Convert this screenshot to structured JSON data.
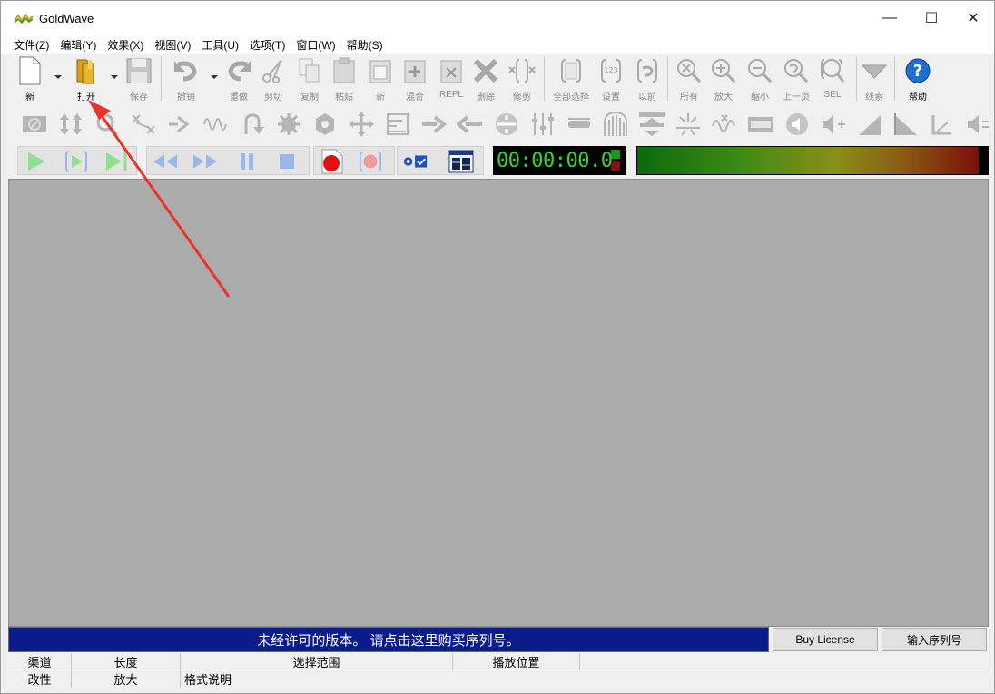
{
  "window": {
    "title": "GoldWave"
  },
  "window_controls": {
    "minimize": "—",
    "maximize": "☐",
    "close": "✕"
  },
  "menu": [
    "文件(Z)",
    "编辑(Y)",
    "效果(X)",
    "视图(V)",
    "工具(U)",
    "选项(T)",
    "窗口(W)",
    "帮助(S)"
  ],
  "toolbar_main": {
    "new": "新",
    "open": "打开",
    "save": "保存",
    "undo": "撤销",
    "redo": "重做",
    "cut": "剪切",
    "copy": "复制",
    "paste": "粘贴",
    "paste_new": "新",
    "mix": "混合",
    "replace": "REPL",
    "delete": "删除",
    "trim": "修剪",
    "select_all": "全部选择",
    "set": "设置",
    "previous": "以前",
    "all": "所有",
    "zoom_in": "放大",
    "zoom_out": "缩小",
    "prev_page": "上一页",
    "sel": "SEL",
    "cue": "线索",
    "help": "帮助"
  },
  "timer": {
    "value": "00:00:00.0"
  },
  "license": {
    "message": "未经许可的版本。 请点击这里购买序列号。",
    "buy_label": "Buy License",
    "serial_label": "输入序列号"
  },
  "status": {
    "channel": "渠道",
    "length": "长度",
    "selection": "选择范围",
    "play_position": "播放位置",
    "modified": "改性",
    "zoom": "放大",
    "format": "格式说明"
  },
  "colors": {
    "license_bg": "#0a1c8c",
    "workspace": "#ababab",
    "timer_text": "#2bdc2b",
    "annotation_arrow": "#e8342a"
  }
}
